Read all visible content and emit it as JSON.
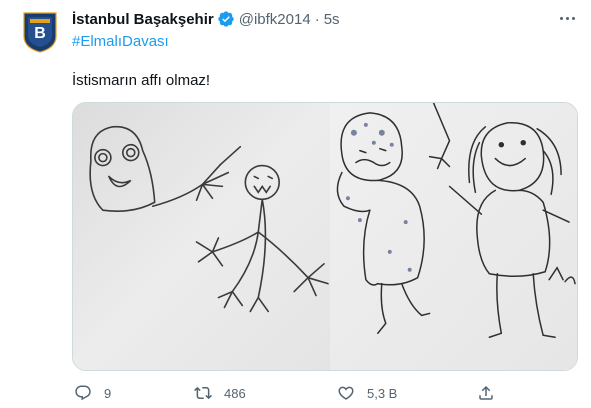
{
  "user": {
    "display_name": "İstanbul Başakşehir",
    "handle": "@ibfk2014",
    "separator": "·",
    "time": "5s"
  },
  "tweet": {
    "hashtag": "#ElmalıDavası",
    "text": "İstismarın affı olmaz!"
  },
  "actions": {
    "replies": "9",
    "retweets": "486",
    "likes": "5,3 B"
  },
  "colors": {
    "link": "#1d9bf0",
    "secondary_text": "#536471",
    "verified": "#1d9bf0",
    "avatar_brand": "#1a3b6e"
  },
  "icons": [
    "verified-badge-icon",
    "more-icon",
    "reply-icon",
    "retweet-icon",
    "like-icon",
    "share-icon",
    "club-crest-icon"
  ]
}
